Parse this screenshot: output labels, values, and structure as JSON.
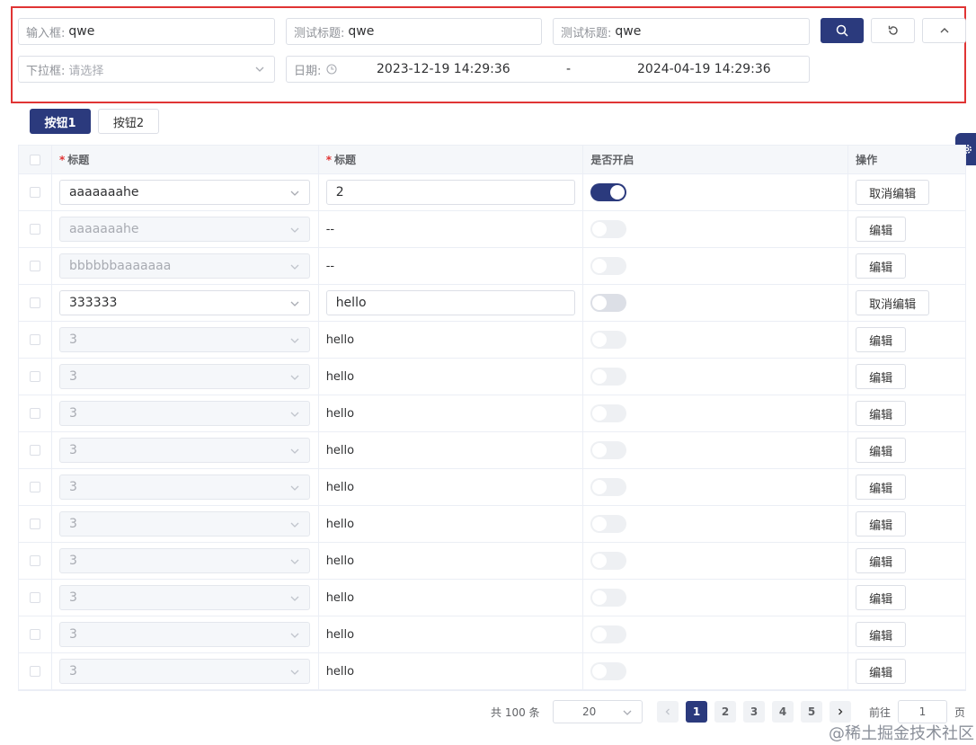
{
  "search": {
    "input_label": "输入框:",
    "input_value": "qwe",
    "title1_label": "测试标题:",
    "title1_value": "qwe",
    "title2_label": "测试标题:",
    "title2_value": "qwe",
    "dropdown_label": "下拉框:",
    "dropdown_placeholder": "请选择",
    "date_label": "日期:",
    "date_start": "2023-12-19 14:29:36",
    "date_sep": "-",
    "date_end": "2024-04-19 14:29:36"
  },
  "toolbar": {
    "button1": "按钮1",
    "button2": "按钮2"
  },
  "table": {
    "headers": {
      "title_a": "标题",
      "title_b": "标题",
      "enabled": "是否开启",
      "actions": "操作"
    },
    "rows": [
      {
        "select": "aaaaaaahe",
        "select_disabled": false,
        "text": "2",
        "text_input": true,
        "switch": "on",
        "action": "取消编辑"
      },
      {
        "select": "aaaaaaahe",
        "select_disabled": true,
        "text": "--",
        "text_input": false,
        "switch": "disabled",
        "action": "编辑"
      },
      {
        "select": "bbbbbbaaaaaaa",
        "select_disabled": true,
        "text": "--",
        "text_input": false,
        "switch": "disabled",
        "action": "编辑"
      },
      {
        "select": "333333",
        "select_disabled": false,
        "text": "hello",
        "text_input": true,
        "switch": "off",
        "action": "取消编辑"
      },
      {
        "select": "3",
        "select_disabled": true,
        "text": "hello",
        "text_input": false,
        "switch": "disabled",
        "action": "编辑"
      },
      {
        "select": "3",
        "select_disabled": true,
        "text": "hello",
        "text_input": false,
        "switch": "disabled",
        "action": "编辑"
      },
      {
        "select": "3",
        "select_disabled": true,
        "text": "hello",
        "text_input": false,
        "switch": "disabled",
        "action": "编辑"
      },
      {
        "select": "3",
        "select_disabled": true,
        "text": "hello",
        "text_input": false,
        "switch": "disabled",
        "action": "编辑"
      },
      {
        "select": "3",
        "select_disabled": true,
        "text": "hello",
        "text_input": false,
        "switch": "disabled",
        "action": "编辑"
      },
      {
        "select": "3",
        "select_disabled": true,
        "text": "hello",
        "text_input": false,
        "switch": "disabled",
        "action": "编辑"
      },
      {
        "select": "3",
        "select_disabled": true,
        "text": "hello",
        "text_input": false,
        "switch": "disabled",
        "action": "编辑"
      },
      {
        "select": "3",
        "select_disabled": true,
        "text": "hello",
        "text_input": false,
        "switch": "disabled",
        "action": "编辑"
      },
      {
        "select": "3",
        "select_disabled": true,
        "text": "hello",
        "text_input": false,
        "switch": "disabled",
        "action": "编辑"
      },
      {
        "select": "3",
        "select_disabled": true,
        "text": "hello",
        "text_input": false,
        "switch": "disabled",
        "action": "编辑"
      }
    ]
  },
  "pagination": {
    "total": "共 100 条",
    "page_size": "20",
    "pages": [
      "1",
      "2",
      "3",
      "4",
      "5"
    ],
    "current": "1",
    "goto_prefix": "前往",
    "goto_value": "1",
    "goto_suffix": "页"
  },
  "watermark": "@稀土掘金技术社区",
  "colors": {
    "primary": "#2b3a7d",
    "highlight_border": "#e03434"
  },
  "icons": {
    "search": "search-icon",
    "reset": "reset-icon",
    "collapse": "chevron-up-icon",
    "settings": "gear-icon",
    "clock": "clock-icon"
  }
}
